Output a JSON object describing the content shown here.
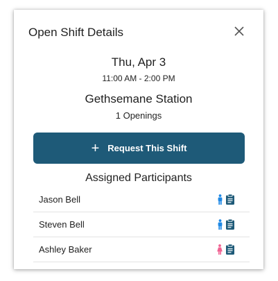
{
  "dialog": {
    "title": "Open Shift Details"
  },
  "shift": {
    "date": "Thu, Apr 3",
    "time": "11:00 AM - 2:00 PM",
    "station": "Gethsemane Station",
    "openings": "1 Openings"
  },
  "request_button": {
    "icon": "+",
    "label": "Request This Shift"
  },
  "participants": {
    "title": "Assigned Participants",
    "items": [
      {
        "name": "Jason Bell",
        "gender_icon": "male-icon",
        "icon_color": "#1e88e5"
      },
      {
        "name": "Steven Bell",
        "gender_icon": "male-icon",
        "icon_color": "#1e88e5"
      },
      {
        "name": "Ashley Baker",
        "gender_icon": "female-icon",
        "icon_color": "#f06292"
      }
    ]
  },
  "colors": {
    "primary_button": "#1e5a78",
    "clipboard": "#1e5a78",
    "male": "#1e88e5",
    "female": "#f06292"
  }
}
